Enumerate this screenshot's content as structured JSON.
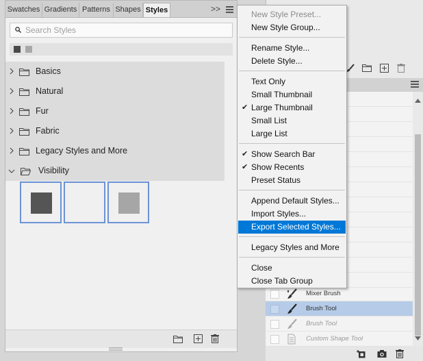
{
  "tabs": [
    {
      "label": "Swatches",
      "active": false
    },
    {
      "label": "Gradients",
      "active": false
    },
    {
      "label": "Patterns",
      "active": false
    },
    {
      "label": "Shapes",
      "active": false
    },
    {
      "label": "Styles",
      "active": true
    }
  ],
  "collapse_glyph": ">>",
  "search": {
    "placeholder": "Search Styles",
    "value": ""
  },
  "groups": [
    {
      "label": "Basics",
      "expanded": false
    },
    {
      "label": "Natural",
      "expanded": false
    },
    {
      "label": "Fur",
      "expanded": false
    },
    {
      "label": "Fabric",
      "expanded": false
    },
    {
      "label": "Legacy Styles and More",
      "expanded": false
    },
    {
      "label": "Visibility",
      "expanded": true
    }
  ],
  "visibility_swatches": [
    {
      "fill": "#555555",
      "selected": true
    },
    {
      "fill": "#f0f0f0",
      "selected": true
    },
    {
      "fill": "#a6a6a6",
      "selected": true
    }
  ],
  "menu": {
    "items": [
      {
        "label": "New Style Preset...",
        "disabled": true
      },
      {
        "label": "New Style Group..."
      },
      {
        "separator": true
      },
      {
        "label": "Rename Style..."
      },
      {
        "label": "Delete Style..."
      },
      {
        "separator": true
      },
      {
        "label": "Text Only"
      },
      {
        "label": "Small Thumbnail"
      },
      {
        "label": "Large Thumbnail",
        "checked": true
      },
      {
        "label": "Small List"
      },
      {
        "label": "Large List"
      },
      {
        "separator": true
      },
      {
        "label": "Show Search Bar",
        "checked": true
      },
      {
        "label": "Show Recents",
        "checked": true
      },
      {
        "label": "Preset Status"
      },
      {
        "separator": true
      },
      {
        "label": "Append Default Styles..."
      },
      {
        "label": "Import Styles..."
      },
      {
        "label": "Export Selected Styles...",
        "highlighted": true
      },
      {
        "separator": true
      },
      {
        "label": "Legacy Styles and More"
      },
      {
        "separator": true
      },
      {
        "label": "Close"
      },
      {
        "label": "Close Tab Group"
      }
    ]
  },
  "tool_list": [
    {
      "label": "Mixer Brush",
      "selected": false,
      "dim": false
    },
    {
      "label": "Brush Tool",
      "selected": true,
      "dim": false
    },
    {
      "label": "Brush Tool",
      "selected": false,
      "dim": true
    },
    {
      "label": "Custom Shape Tool",
      "selected": false,
      "dim": true
    }
  ],
  "colors": {
    "accent_highlight": "#0078d7",
    "swatch_border": "#6b93d6",
    "selected_row": "#b5cbe8"
  }
}
